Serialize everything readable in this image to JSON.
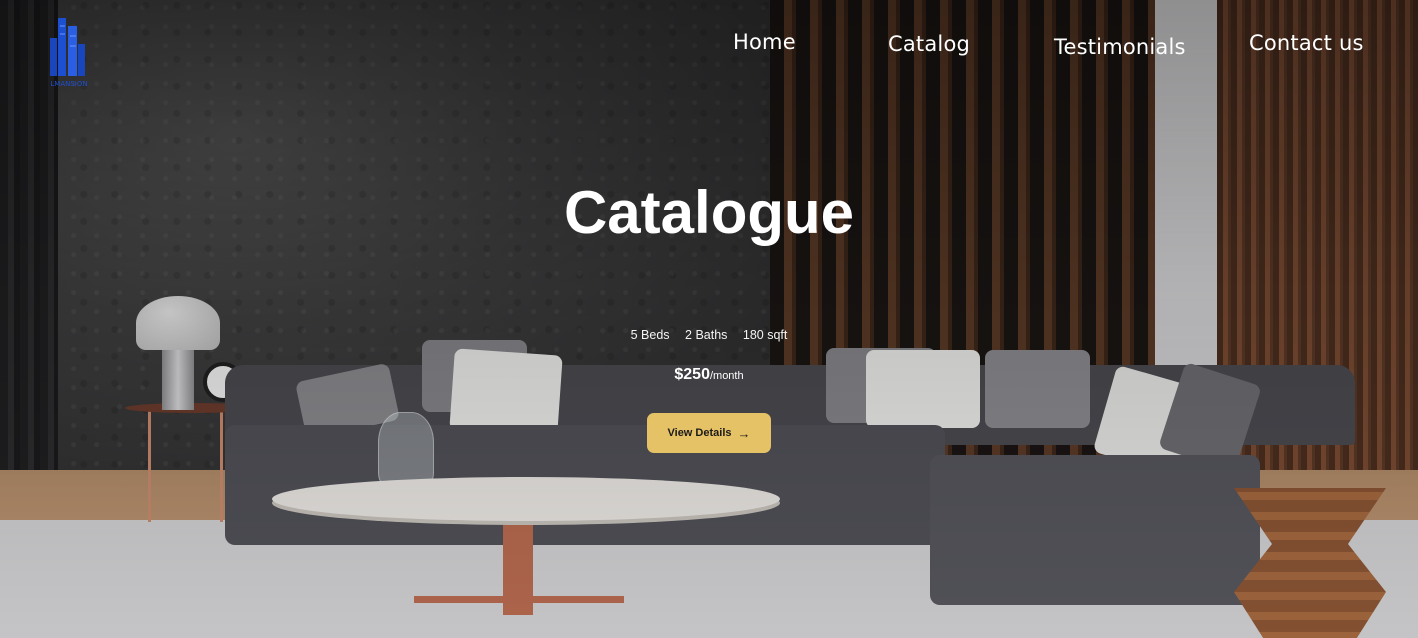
{
  "brand": {
    "logo_text": "LMANSION",
    "logo_color": "#1d4fd1"
  },
  "nav": {
    "items": [
      {
        "label": "Home"
      },
      {
        "label": "Catalog"
      },
      {
        "label": "Testimonials"
      },
      {
        "label": "Contact us"
      }
    ]
  },
  "hero": {
    "title": "Catalogue",
    "specs": {
      "beds": "5 Beds",
      "baths": "2 Baths",
      "area": "180 sqft"
    },
    "price": {
      "amount": "$250",
      "period": "/month"
    },
    "cta": {
      "label": "View Details",
      "icon": "arrow-right-icon",
      "color": "#e6c266"
    }
  }
}
